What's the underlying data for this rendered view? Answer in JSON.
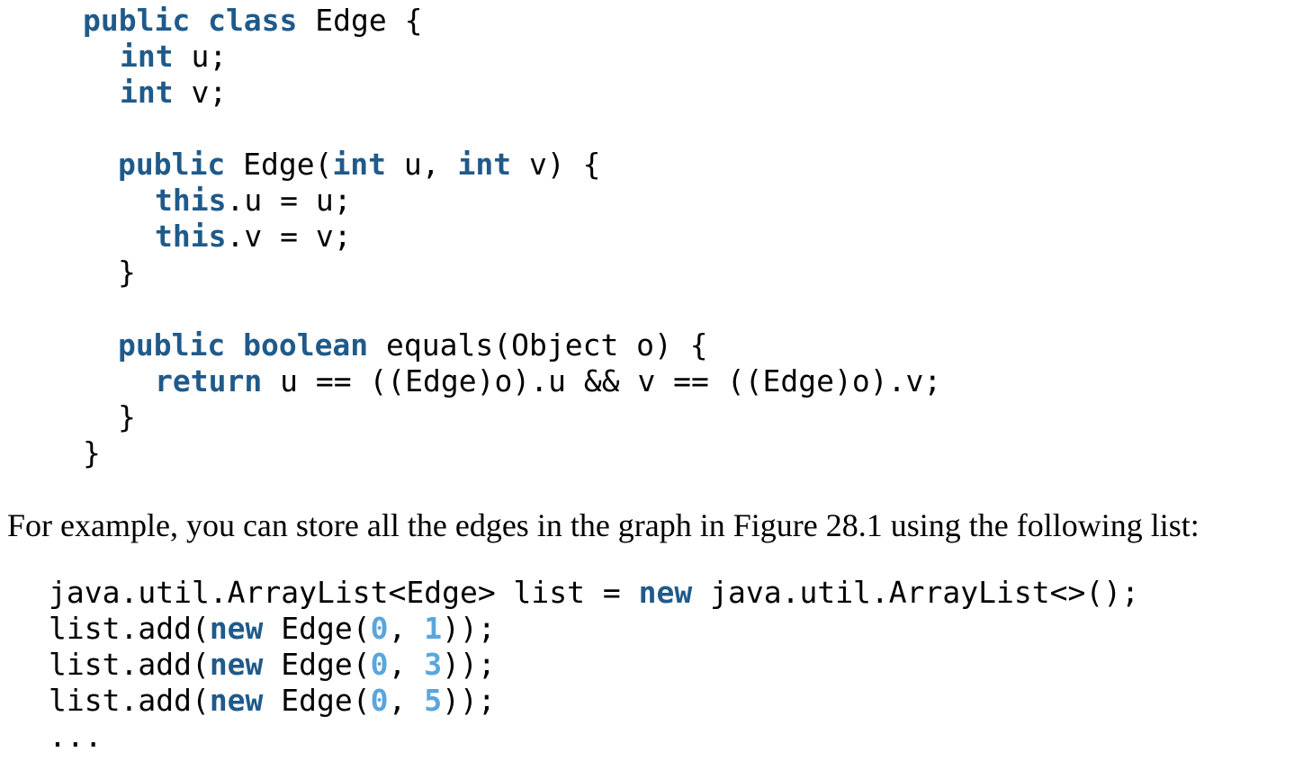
{
  "class_code": {
    "l1": {
      "kw1": "public class",
      "rest": " Edge {"
    },
    "l2": {
      "kw1": "int",
      "rest": " u;"
    },
    "l3": {
      "kw1": "int",
      "rest": " v;"
    },
    "l5": {
      "kw1": "public",
      "a": " Edge(",
      "kw2": "int",
      "b": " u, ",
      "kw3": "int",
      "c": " v) {"
    },
    "l6": {
      "kw1": "this",
      "rest": ".u = u;"
    },
    "l7": {
      "kw1": "this",
      "rest": ".v = v;"
    },
    "l8": {
      "rest": "}"
    },
    "l10": {
      "kw1": "public",
      "sp": " ",
      "kw2": "boolean",
      "rest": " equals(Object o) {"
    },
    "l11": {
      "kw1": "return",
      "rest": " u == ((Edge)o).u && v == ((Edge)o).v;"
    },
    "l12": {
      "rest": "}"
    },
    "l13": {
      "rest": "}"
    }
  },
  "paragraph": "For example, you can store all the edges in the graph in Figure 28.1 using the following list:",
  "list_code": {
    "l1": {
      "a": "java.util.ArrayList<Edge> list = ",
      "kw": "new",
      "b": " java.util.ArrayList<>();"
    },
    "l2": {
      "a": "list.add(",
      "kw": "new",
      "b": " Edge(",
      "n1": "0",
      "c": ", ",
      "n2": "1",
      "d": "));"
    },
    "l3": {
      "a": "list.add(",
      "kw": "new",
      "b": " Edge(",
      "n1": "0",
      "c": ", ",
      "n2": "3",
      "d": "));"
    },
    "l4": {
      "a": "list.add(",
      "kw": "new",
      "b": " Edge(",
      "n1": "0",
      "c": ", ",
      "n2": "5",
      "d": "));"
    },
    "l5": {
      "a": "..."
    }
  },
  "colors": {
    "keyword": "#1f5a8a",
    "number": "#5aa6dc",
    "text": "#000000"
  }
}
